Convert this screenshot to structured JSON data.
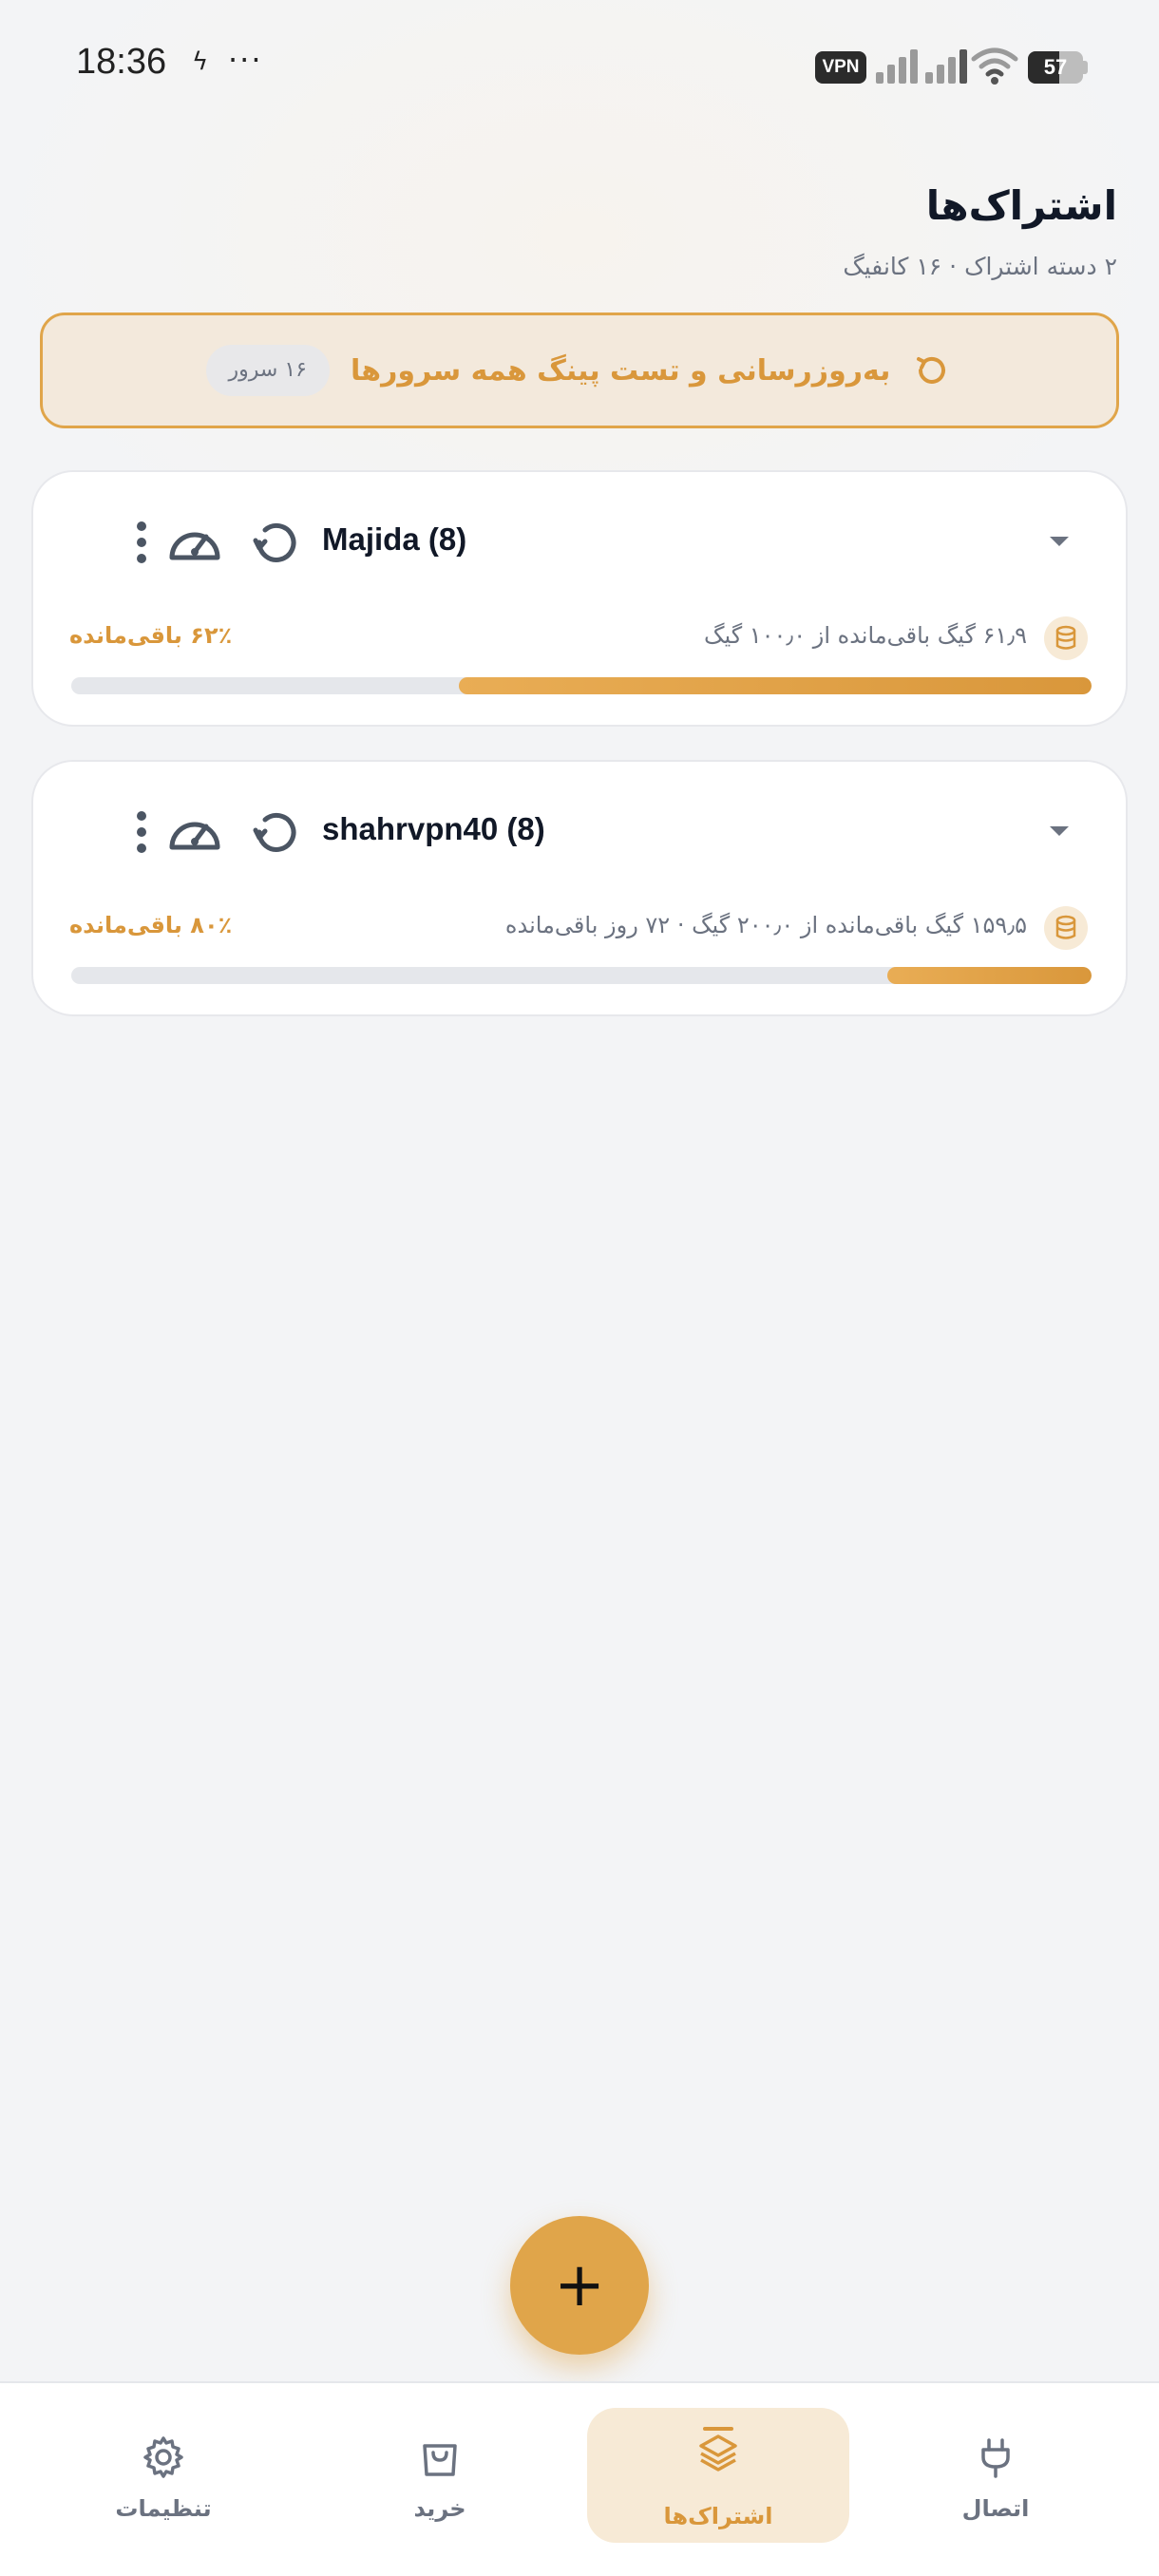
{
  "status_bar": {
    "time": "18:36",
    "bolt": "ϟ",
    "dots": "···",
    "vpn": "VPN",
    "battery": "57",
    "battery_level": 0.57
  },
  "header": {
    "title": "اشتراک‌ها",
    "subtitle": "۲ دسته اشتراک · ۱۶ کانفیگ"
  },
  "refresh_banner": {
    "label": "به‌روزرسانی و تست پینگ همه سرورها",
    "servers_badge": "۱۶ سرور",
    "icon": "refresh-icon"
  },
  "subscriptions": [
    {
      "name": "Majida (8)",
      "usage": "۶۱٫۹ گیگ باقی‌مانده از ۱۰۰٫۰ گیگ",
      "percent_label": "۶۲٪ باقی‌مانده",
      "remaining_fraction": 0.62
    },
    {
      "name": "shahrvpn40 (8)",
      "usage": "۱۵۹٫۵ گیگ باقی‌مانده از ۲۰۰٫۰ گیگ · ۷۲ روز باقی‌مانده",
      "percent_label": "۸۰٪ باقی‌مانده",
      "remaining_fraction": 0.2
    }
  ],
  "fab": {
    "label": "+"
  },
  "bottom_nav": {
    "items": [
      {
        "label": "تنظیمات",
        "icon": "gear-icon"
      },
      {
        "label": "خرید",
        "icon": "shopping-bag-icon"
      },
      {
        "label": "اشتراک‌ها",
        "icon": "layers-icon",
        "active": true
      },
      {
        "label": "اتصال",
        "icon": "plug-icon"
      }
    ]
  },
  "colors": {
    "accent": "#e0a54a",
    "accent_text": "#d9973b",
    "background": "#f3f4f6",
    "card": "#ffffff"
  }
}
